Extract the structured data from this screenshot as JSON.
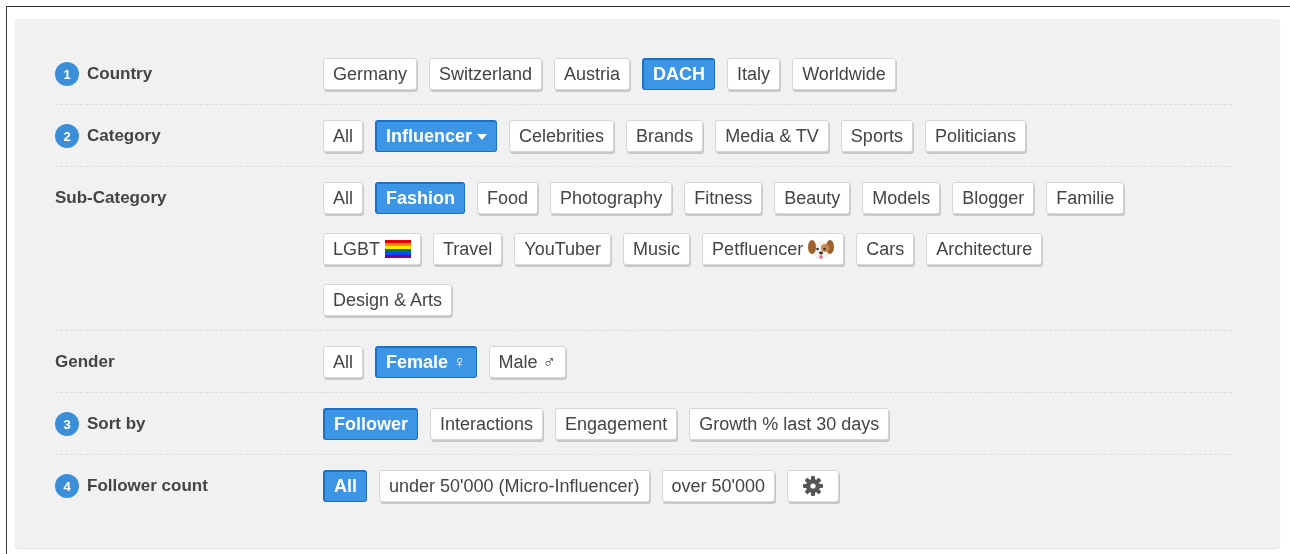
{
  "filters": [
    {
      "step": "1",
      "label": "Country",
      "options": [
        {
          "label": "Germany",
          "selected": false
        },
        {
          "label": "Switzerland",
          "selected": false
        },
        {
          "label": "Austria",
          "selected": false
        },
        {
          "label": "DACH",
          "selected": true
        },
        {
          "label": "Italy",
          "selected": false
        },
        {
          "label": "Worldwide",
          "selected": false
        }
      ]
    },
    {
      "step": "2",
      "label": "Category",
      "options": [
        {
          "label": "All",
          "selected": false
        },
        {
          "label": "Influencer",
          "selected": true,
          "kind": "dropdown"
        },
        {
          "label": "Celebrities",
          "selected": false
        },
        {
          "label": "Brands",
          "selected": false
        },
        {
          "label": "Media & TV",
          "selected": false
        },
        {
          "label": "Sports",
          "selected": false
        },
        {
          "label": "Politicians",
          "selected": false
        }
      ]
    },
    {
      "label": "Sub-Category",
      "options": [
        {
          "label": "All",
          "selected": false
        },
        {
          "label": "Fashion",
          "selected": true
        },
        {
          "label": "Food",
          "selected": false
        },
        {
          "label": "Photography",
          "selected": false
        },
        {
          "label": "Fitness",
          "selected": false
        },
        {
          "label": "Beauty",
          "selected": false
        },
        {
          "label": "Models",
          "selected": false
        },
        {
          "label": "Blogger",
          "selected": false
        },
        {
          "label": "Familie",
          "selected": false
        },
        {
          "label": "LGBT",
          "selected": false,
          "kind": "flag"
        },
        {
          "label": "Travel",
          "selected": false
        },
        {
          "label": "YouTuber",
          "selected": false
        },
        {
          "label": "Music",
          "selected": false
        },
        {
          "label": "Petfluencer",
          "selected": false,
          "kind": "dog"
        },
        {
          "label": "Cars",
          "selected": false
        },
        {
          "label": "Architecture",
          "selected": false
        },
        {
          "label": "Design & Arts",
          "selected": false
        }
      ]
    },
    {
      "label": "Gender",
      "options": [
        {
          "label": "All",
          "selected": false
        },
        {
          "label": "Female ♀",
          "selected": true
        },
        {
          "label": "Male ♂",
          "selected": false
        }
      ]
    },
    {
      "step": "3",
      "label": "Sort by",
      "options": [
        {
          "label": "Follower",
          "selected": true
        },
        {
          "label": "Interactions",
          "selected": false
        },
        {
          "label": "Engagement",
          "selected": false
        },
        {
          "label": "Growth % last 30 days",
          "selected": false
        }
      ]
    },
    {
      "step": "4",
      "label": "Follower count",
      "options": [
        {
          "label": "All",
          "selected": true
        },
        {
          "label": "under 50'000 (Micro-Influencer)",
          "selected": false
        },
        {
          "label": "over 50'000",
          "selected": false
        },
        {
          "kind": "settings",
          "selected": false
        }
      ]
    }
  ]
}
